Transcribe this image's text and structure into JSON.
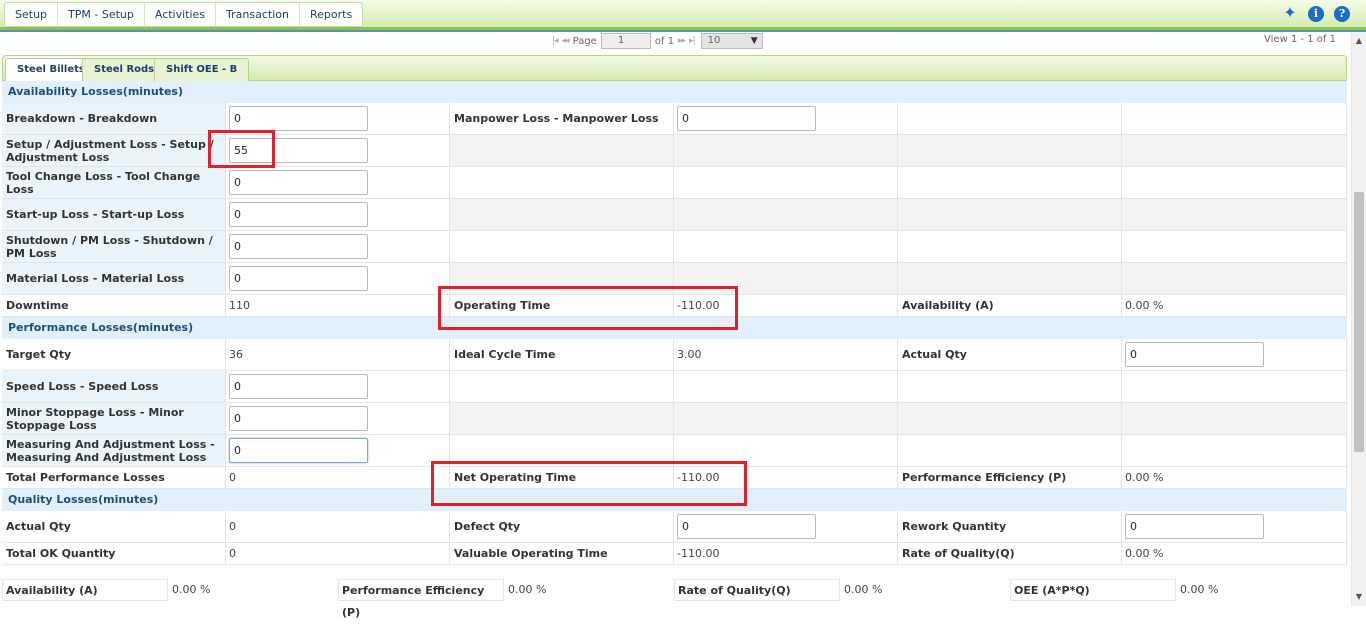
{
  "menu": {
    "items": [
      "Setup",
      "TPM - Setup",
      "Activities",
      "Transaction",
      "Reports"
    ],
    "icons": [
      "pin-icon",
      "info-icon",
      "help-icon"
    ]
  },
  "pager": {
    "page_label": "Page",
    "page_value": "1",
    "of_label": "of 1",
    "rows_value": "10",
    "view_info": "View 1 - 1 of 1"
  },
  "tabs": [
    "Steel Billets",
    "Steel Rods",
    "Shift OEE - B"
  ],
  "availability": {
    "heading": "Availability Losses(minutes)",
    "breakdown_label": "Breakdown - Breakdown",
    "breakdown_value": "0",
    "manpower_label": "Manpower Loss - Manpower Loss",
    "manpower_value": "0",
    "setup_label": "Setup / Adjustment Loss - Setup / Adjustment Loss",
    "setup_value": "55",
    "toolchange_label": "Tool Change Loss - Tool Change Loss",
    "toolchange_value": "0",
    "startup_label": "Start-up Loss - Start-up Loss",
    "startup_value": "0",
    "shutdown_label": "Shutdown / PM Loss - Shutdown / PM Loss",
    "shutdown_value": "0",
    "material_label": "Material Loss - Material Loss",
    "material_value": "0",
    "downtime_label": "Downtime",
    "downtime_value": "110",
    "operating_label": "Operating Time",
    "operating_value": "-110.00",
    "avail_label": "Availability (A)",
    "avail_value": "0.00 %"
  },
  "performance": {
    "heading": "Performance Losses(minutes)",
    "target_label": "Target Qty",
    "target_value": "36",
    "cycle_label": "Ideal Cycle Time",
    "cycle_value": "3.00",
    "actual_label": "Actual Qty",
    "actual_value": "0",
    "speed_label": "Speed Loss - Speed Loss",
    "speed_value": "0",
    "minor_label": "Minor Stoppage Loss - Minor Stoppage Loss",
    "minor_value": "0",
    "measuring_label": "Measuring And Adjustment Loss - Measuring And Adjustment Loss",
    "measuring_value": "0",
    "total_label": "Total Performance Losses",
    "total_value": "0",
    "netop_label": "Net Operating Time",
    "netop_value": "-110.00",
    "perf_label": "Performance Efficiency (P)",
    "perf_value": "0.00 %"
  },
  "quality": {
    "heading": "Quality Losses(minutes)",
    "actual_label": "Actual Qty",
    "actual_value": "0",
    "defect_label": "Defect Qty",
    "defect_value": "0",
    "rework_label": "Rework Quantity",
    "rework_value": "0",
    "totalok_label": "Total OK Quantity",
    "totalok_value": "0",
    "valuable_label": "Valuable Operating Time",
    "valuable_value": "-110.00",
    "roq_label": "Rate of Quality(Q)",
    "roq_value": "0.00 %"
  },
  "summary": {
    "avail_label": "Availability (A)",
    "avail_value": "0.00 %",
    "perf_label": "Performance Efficiency (P)",
    "perf_value": "0.00 %",
    "roq_label": "Rate of Quality(Q)",
    "roq_value": "0.00 %",
    "oee_label": "OEE (A*P*Q)",
    "oee_value": "0.00 %"
  },
  "colors": {
    "highlight": "#e0202a",
    "accent_green": "#8cc63f",
    "section_blue": "#e2f0fb"
  }
}
